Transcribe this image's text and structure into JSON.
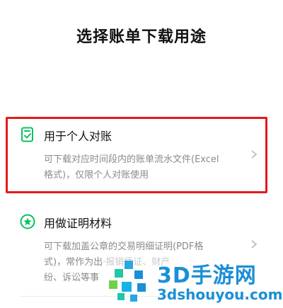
{
  "page": {
    "title": "选择账单下载用途"
  },
  "options": [
    {
      "title": "用于个人对账",
      "description_line1": "可下载对应时间段内的账单流水文件(Excel",
      "description_line2": "格式)，仅限个人对账使用",
      "icon": "document-check-icon"
    },
    {
      "title": "用做证明材料",
      "description_line1": "可下载加盖公章的交易明细证明(PDF格",
      "description_line2": "式)，常作为出",
      "description_line2b": "·报销凭证、财产",
      "description_line3": "纷、诉讼等事",
      "icon": "star-badge-icon"
    }
  ],
  "watermark": {
    "brand_big": "3D手游网",
    "brand_small": "3dshouyou.com"
  },
  "colors": {
    "accent_green": "#07c160",
    "highlight_red": "#e5191d",
    "watermark_blue": "#1b8fd6"
  }
}
